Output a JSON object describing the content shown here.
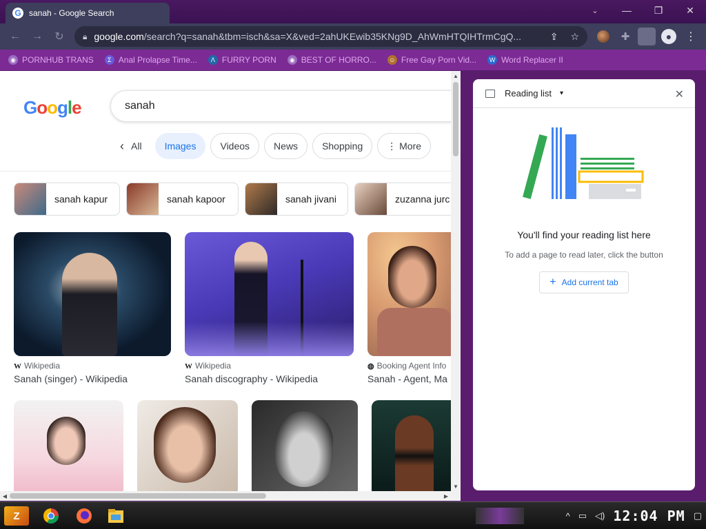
{
  "window": {
    "tab_title": "sanah - Google Search",
    "favicon": "G",
    "controls": {
      "tab_search": "⌄",
      "minimize": "—",
      "restore": "❐",
      "close": "✕"
    }
  },
  "toolbar": {
    "back": "←",
    "forward": "→",
    "reload": "↻",
    "url_host": "google.com",
    "url_rest": "/search?q=sanah&tbm=isch&sa=X&ved=2ahUKEwib35KNg9D_AhWmHTQIHTrmCgQ...",
    "share": "⇪",
    "bookmark_star": "☆",
    "extensions": "✚",
    "profile": "●",
    "menu": "⋮"
  },
  "bookmarks": [
    {
      "label": "PORNHUB TRANS",
      "icon_color": "#9c6cc0",
      "glyph": "◉"
    },
    {
      "label": "Anal Prolapse Time...",
      "icon_color": "#6a5ad8",
      "glyph": "Σ"
    },
    {
      "label": "FURRY PORN",
      "icon_color": "#1e6aa8",
      "glyph": "Λ"
    },
    {
      "label": "BEST OF HORRO...",
      "icon_color": "#9c6cc0",
      "glyph": "◉"
    },
    {
      "label": "Free Gay Porn Vid...",
      "icon_color": "#b07030",
      "glyph": "☺"
    },
    {
      "label": "Word Replacer II",
      "icon_color": "#2a6ad0",
      "glyph": "W"
    }
  ],
  "search": {
    "query": "sanah",
    "tabs": [
      {
        "label": "All",
        "active": false
      },
      {
        "label": "Images",
        "active": true
      },
      {
        "label": "Videos",
        "active": false
      },
      {
        "label": "News",
        "active": false
      },
      {
        "label": "Shopping",
        "active": false
      },
      {
        "label": "⋮ More",
        "active": false
      }
    ],
    "back_chevron": "‹",
    "related": [
      {
        "label": "sanah kapur"
      },
      {
        "label": "sanah kapoor"
      },
      {
        "label": "sanah jivani"
      },
      {
        "label": "zuzanna jurc"
      }
    ],
    "results": [
      {
        "source": "Wikipedia",
        "source_icon": "W",
        "title": "Sanah (singer) - Wikipedia"
      },
      {
        "source": "Wikipedia",
        "source_icon": "W",
        "title": "Sanah discography - Wikipedia"
      },
      {
        "source": "Booking Agent Info",
        "source_icon": "◍",
        "title": "Sanah - Agent, Ma"
      }
    ]
  },
  "reading_list": {
    "header": "Reading list",
    "caret": "▾",
    "close": "✕",
    "empty_title": "You'll find your reading list here",
    "empty_subtitle": "To add a page to read later, click the button",
    "add_button": "Add current tab",
    "add_icon": "+"
  },
  "taskbar": {
    "start_glyph": "Z",
    "clock": "12:04 PM",
    "tray": {
      "up": "^",
      "network": "▭",
      "volume": "◁)",
      "notifications": "▢"
    }
  }
}
